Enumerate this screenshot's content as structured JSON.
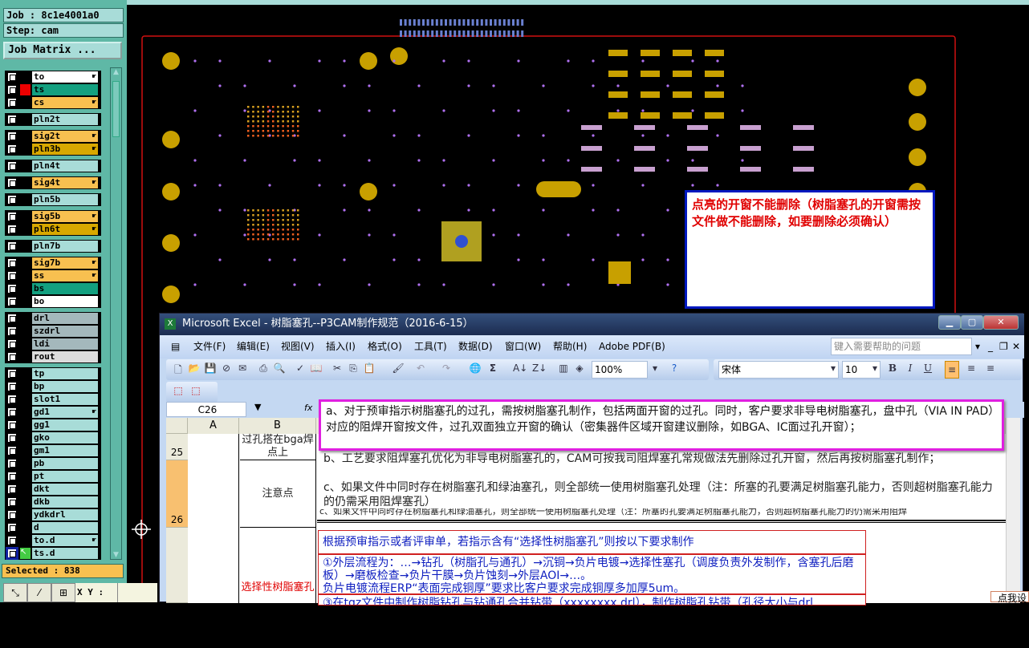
{
  "left_panel": {
    "job": "Job : 8c1e4001a0",
    "step": "Step: cam",
    "job_matrix": "Job Matrix ...",
    "selected": "Selected : 838",
    "xy_label": "X Y :",
    "layers": [
      {
        "name": "to",
        "color": "#ffffff",
        "group": 0,
        "hand": true
      },
      {
        "name": "ts",
        "color": "#13a080",
        "group": 0,
        "hand": false,
        "active": true
      },
      {
        "name": "cs",
        "color": "#f8c050",
        "group": 0,
        "hand": true
      },
      {
        "name": "pln2t",
        "color": "#a8dcd8",
        "group": 1,
        "hand": false
      },
      {
        "name": "sig2t",
        "color": "#f8c050",
        "group": 2,
        "hand": true
      },
      {
        "name": "pln3b",
        "color": "#d8a800",
        "group": 2,
        "hand": true
      },
      {
        "name": "pln4t",
        "color": "#a8dcd8",
        "group": 3,
        "hand": false
      },
      {
        "name": "sig4t",
        "color": "#f8c050",
        "group": 4,
        "hand": true
      },
      {
        "name": "pln5b",
        "color": "#a8dcd8",
        "group": 5,
        "hand": false
      },
      {
        "name": "sig5b",
        "color": "#f8c050",
        "group": 6,
        "hand": true
      },
      {
        "name": "pln6t",
        "color": "#d8a800",
        "group": 6,
        "hand": true
      },
      {
        "name": "pln7b",
        "color": "#a8dcd8",
        "group": 7,
        "hand": false
      },
      {
        "name": "sig7b",
        "color": "#f8c050",
        "group": 8,
        "hand": true
      },
      {
        "name": "ss",
        "color": "#f8c050",
        "group": 8,
        "hand": true
      },
      {
        "name": "bs",
        "color": "#13a080",
        "group": 8,
        "hand": false
      },
      {
        "name": "bo",
        "color": "#ffffff",
        "group": 8,
        "hand": false
      },
      {
        "name": "drl",
        "color": "#a4b8bc",
        "group": 9,
        "hand": false
      },
      {
        "name": "szdrl",
        "color": "#a4b8bc",
        "group": 9,
        "hand": false
      },
      {
        "name": "ldi",
        "color": "#a4b8bc",
        "group": 9,
        "hand": false
      },
      {
        "name": "rout",
        "color": "#dcdcdc",
        "group": 9,
        "hand": false
      },
      {
        "name": "tp",
        "color": "#a8dcd8",
        "group": 10,
        "hand": false
      },
      {
        "name": "bp",
        "color": "#a8dcd8",
        "group": 10,
        "hand": false
      },
      {
        "name": "slot1",
        "color": "#a8dcd8",
        "group": 10,
        "hand": false
      },
      {
        "name": "gd1",
        "color": "#a8dcd8",
        "group": 10,
        "hand": true
      },
      {
        "name": "gg1",
        "color": "#a8dcd8",
        "group": 10,
        "hand": false
      },
      {
        "name": "gko",
        "color": "#a8dcd8",
        "group": 10,
        "hand": false
      },
      {
        "name": "gm1",
        "color": "#a8dcd8",
        "group": 10,
        "hand": false
      },
      {
        "name": "pb",
        "color": "#a8dcd8",
        "group": 10,
        "hand": false
      },
      {
        "name": "pt",
        "color": "#a8dcd8",
        "group": 10,
        "hand": false
      },
      {
        "name": "dkt",
        "color": "#a8dcd8",
        "group": 10,
        "hand": false
      },
      {
        "name": "dkb",
        "color": "#a8dcd8",
        "group": 10,
        "hand": false
      },
      {
        "name": "ydkdrl",
        "color": "#a8dcd8",
        "group": 10,
        "hand": false
      },
      {
        "name": "d",
        "color": "#a8dcd8",
        "group": 10,
        "hand": false
      },
      {
        "name": "to.d",
        "color": "#a8dcd8",
        "group": 10,
        "hand": true
      },
      {
        "name": "ts.d",
        "color": "#a8dcd8",
        "group": 10,
        "hand": false,
        "selected_row": true
      }
    ]
  },
  "annotation": {
    "text": "点亮的开窗不能删除（树脂塞孔的开窗需按文件做不能删除，如要删除必须确认）"
  },
  "excel": {
    "title": "Microsoft Excel - 树脂塞孔--P3CAM制作规范（2016-6-15）",
    "menu": [
      "文件(F)",
      "编辑(E)",
      "视图(V)",
      "插入(I)",
      "格式(O)",
      "工具(T)",
      "数据(D)",
      "窗口(W)",
      "帮助(H)",
      "Adobe PDF(B)"
    ],
    "help_placeholder": "键入需要帮助的问题",
    "zoom": "100%",
    "font": "宋体",
    "font_size": "10",
    "name_box": "C26",
    "fx": "fx",
    "columns": [
      "A",
      "B"
    ],
    "rows": [
      {
        "num": "25",
        "b": "过孔搭在bga焊点上"
      },
      {
        "num": "26",
        "b": "注意点"
      },
      {
        "num": "",
        "b": "选择性树脂塞孔"
      }
    ],
    "editing_text": "a、对于预审指示树脂塞孔的过孔，需按树脂塞孔制作，包括两面开窗的过孔。同时，客户要求非导电树脂塞孔，盘中孔（VIA IN PAD）对应的阻焊开窗按文件，过孔双面独立开窗的确认（密集器件区域开窗建议删除，如BGA、IC面过孔开窗）；",
    "cell_b_text": "b、工艺要求阻焊塞孔优化为非导电树脂塞孔的，CAM可按我司阻焊塞孔常规做法先删除过孔开窗，然后再按树脂塞孔制作；",
    "cell_c_text": "c、如果文件中同时存在树脂塞孔和绿油塞孔，则全部统一使用树脂塞孔处理（注：所塞的孔要满足树脂塞孔能力，否则超树脂塞孔能力的仍需采用阻焊塞孔）",
    "cell_clipped_text": "c、如果文件中同时存在树脂塞孔和绿油塞孔，则全部统一使用树脂塞孔处理（注：所塞的孔要满足树脂塞孔能力，否则超树脂塞孔能力的仍需采用阻焊",
    "selective": [
      "根据预审指示或者评审单，若指示含有“选择性树脂塞孔”则按以下要求制作",
      "①外层流程为：…→钻孔（树脂孔与通孔）→沉铜→负片电镀→选择性塞孔（调度负责外发制作，含塞孔后磨板）→磨板检查→负片干膜→负片蚀刻→外层AOI→…。\n负片电镀流程ERP“表面完成铜厚”要求比客户要求完成铜厚多加厚5um。",
      "③在tgz文件中制作树脂钻孔与钻通孔合并钻带（xxxxxxxx.drl），制作树脂孔钻带（孔径大小与drl"
    ]
  },
  "popup_hint": "点我设"
}
